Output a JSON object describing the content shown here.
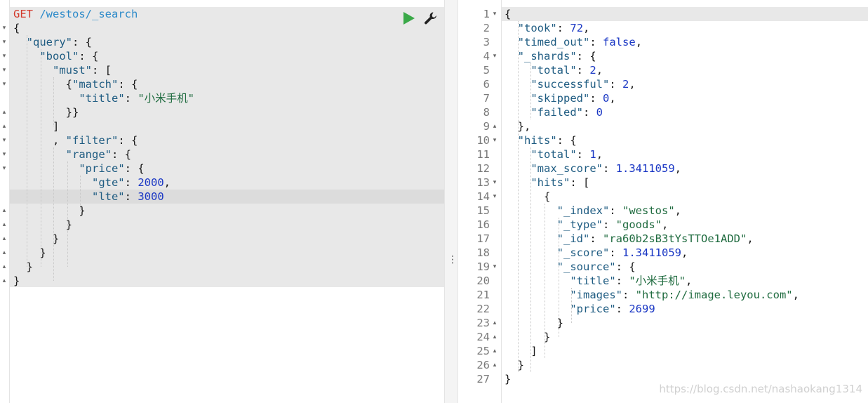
{
  "request": {
    "method": "GET",
    "path": "/westos/_search",
    "lines": [
      "{",
      "  \"query\": {",
      "    \"bool\": {",
      "      \"must\": [",
      "        {\"match\": {",
      "          \"title\": \"小米手机\"",
      "        }}",
      "      ]",
      "      , \"filter\": {",
      "        \"range\": {",
      "          \"price\": {",
      "            \"gte\": 2000,",
      "            \"lte\": 3000",
      "          }",
      "        }",
      "      }",
      "    }",
      "  }",
      "}"
    ]
  },
  "toolbar": {
    "run_icon": "play-icon",
    "settings_icon": "wrench-icon",
    "accent": "#3aa948"
  },
  "divider": {
    "handle_glyph": "⋮"
  },
  "response": {
    "lines": [
      "{",
      "  \"took\": 72,",
      "  \"timed_out\": false,",
      "  \"_shards\": {",
      "    \"total\": 2,",
      "    \"successful\": 2,",
      "    \"skipped\": 0,",
      "    \"failed\": 0",
      "  },",
      "  \"hits\": {",
      "    \"total\": 1,",
      "    \"max_score\": 1.3411059,",
      "    \"hits\": [",
      "      {",
      "        \"_index\": \"westos\",",
      "        \"_type\": \"goods\",",
      "        \"_id\": \"ra60b2sB3tYsTTOe1ADD\",",
      "        \"_score\": 1.3411059,",
      "        \"_source\": {",
      "          \"title\": \"小米手机\",",
      "          \"images\": \"http://image.leyou.com\",",
      "          \"price\": 2699",
      "        }",
      "      }",
      "    ]",
      "  }",
      "}"
    ],
    "line_numbers": [
      "1",
      "2",
      "3",
      "4",
      "5",
      "6",
      "7",
      "8",
      "9",
      "10",
      "11",
      "12",
      "13",
      "14",
      "15",
      "16",
      "17",
      "18",
      "19",
      "20",
      "21",
      "22",
      "23",
      "24",
      "25",
      "26",
      "27"
    ]
  },
  "watermark": "https://blog.csdn.net/nashaokang1314"
}
